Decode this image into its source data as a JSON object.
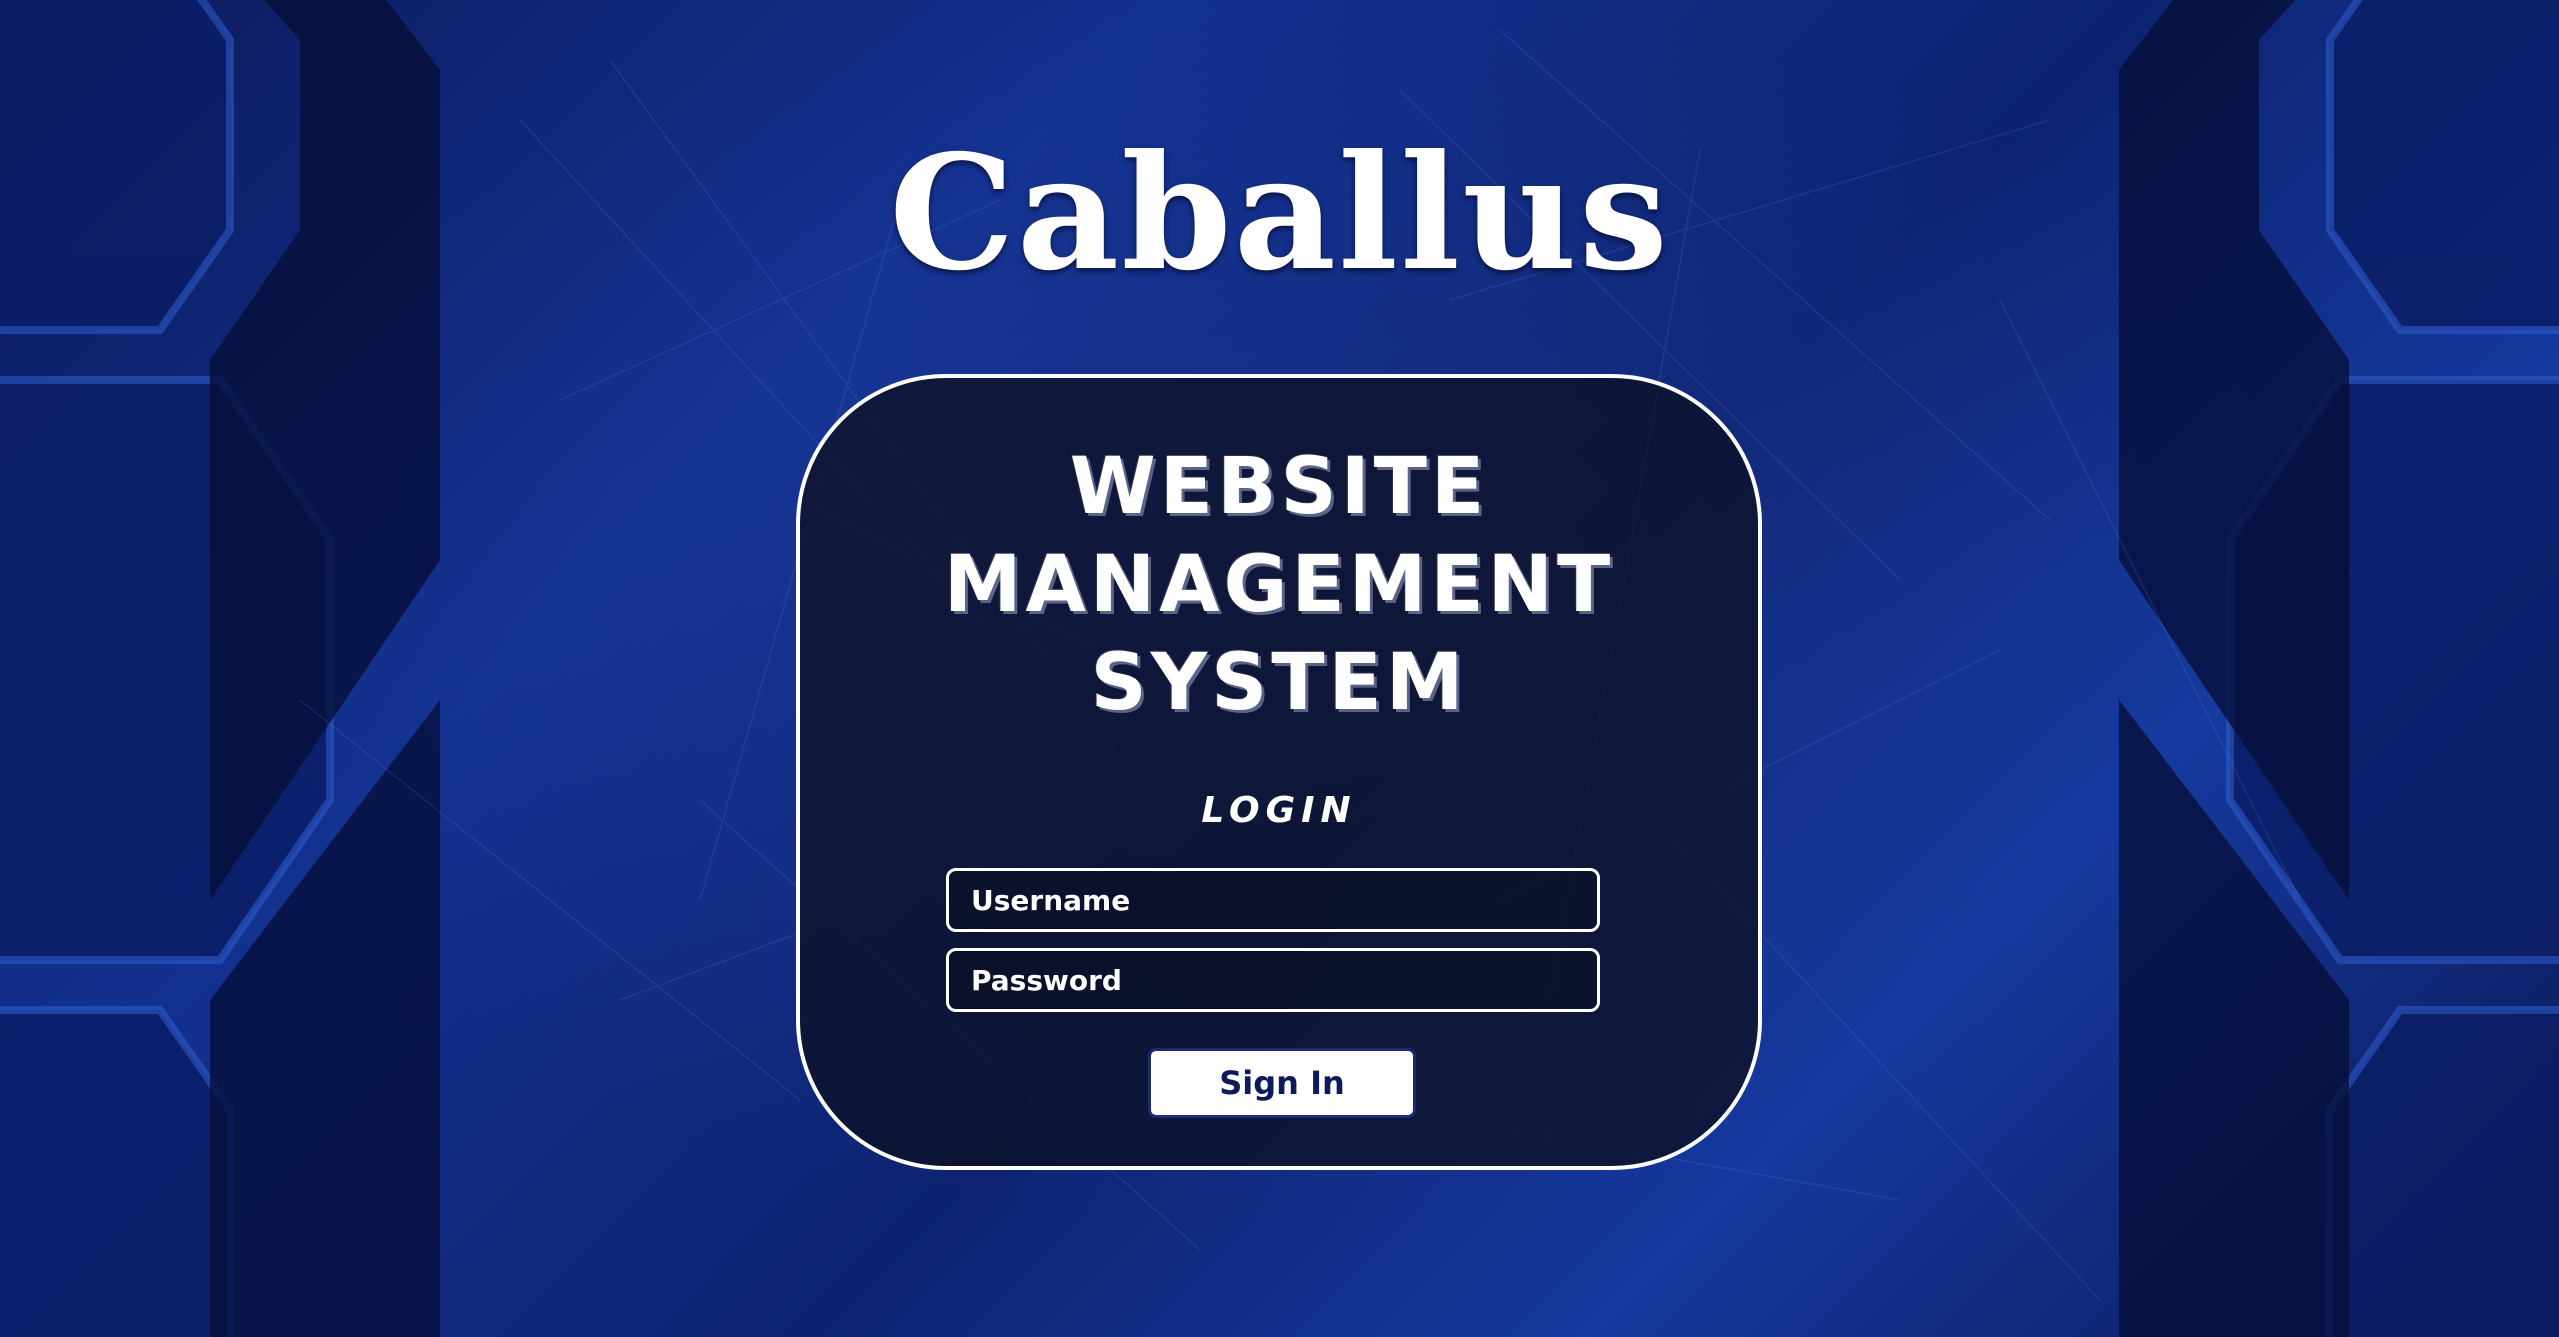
{
  "brand": {
    "name": "Caballus"
  },
  "login_panel": {
    "title": "Website Management System",
    "section_label": "Login",
    "username": {
      "value": "",
      "placeholder": "Username"
    },
    "password": {
      "value": "",
      "placeholder": "Password"
    },
    "signin_label": "Sign In"
  },
  "colors": {
    "background_primary": "#13318f",
    "background_dark": "#0a1650",
    "panel_background": "#0e1228",
    "panel_border": "#ffffff",
    "text": "#ffffff",
    "button_background": "#ffffff",
    "button_text": "#0e1a5c"
  }
}
